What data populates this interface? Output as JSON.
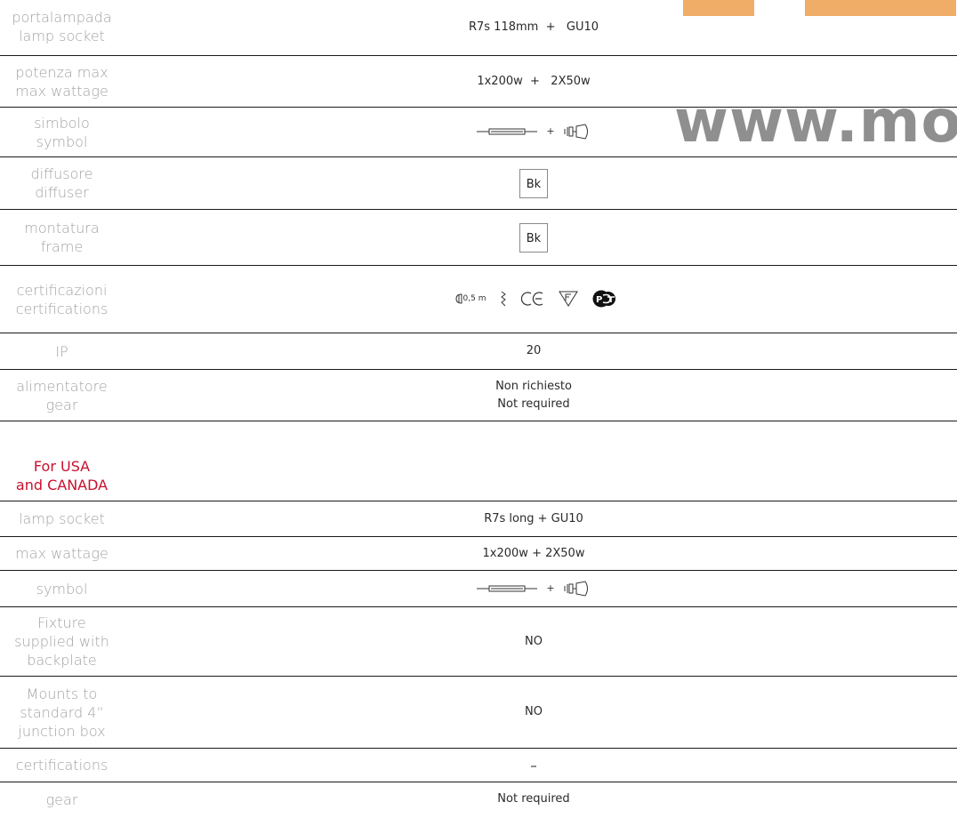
{
  "watermark": {
    "site_text": "www.mo"
  },
  "eu_table": {
    "rows": [
      {
        "label": "portalampada\nlamp socket",
        "value": "R7s 118mm  +   GU10"
      },
      {
        "label": "potenza max\nmax wattage",
        "value": "1x200w  +   2X50w"
      },
      {
        "label": "simbolo\nsymbol",
        "plus": "+"
      },
      {
        "label": "diffusore\ndiffuser",
        "box": "Bk"
      },
      {
        "label": "montatura\nframe",
        "box": "Bk"
      },
      {
        "label": "certificazioni\ncertifications",
        "cert_distance": "0,5 m"
      },
      {
        "label": "IP",
        "value": "20"
      },
      {
        "label": "alimentatore\ngear",
        "value": "Non richiesto\nNot required"
      }
    ]
  },
  "usa_section": {
    "title": "For USA\nand CANADA",
    "rows": [
      {
        "label": "lamp socket",
        "value": "R7s long + GU10"
      },
      {
        "label": "max wattage",
        "value": "1x200w + 2X50w"
      },
      {
        "label": "symbol",
        "plus": "+"
      },
      {
        "label": "Fixture\nsupplied with\nbackplate",
        "value": "NO"
      },
      {
        "label": "Mounts to\nstandard 4”\njunction box",
        "value": "NO"
      },
      {
        "label": "certifications",
        "value": "–"
      },
      {
        "label": "gear",
        "value": "Not required"
      }
    ]
  },
  "colors": {
    "accent_red": "#c8102e",
    "watermark_orange": "#f0ad68",
    "watermark_gray": "#8f8f8f"
  }
}
